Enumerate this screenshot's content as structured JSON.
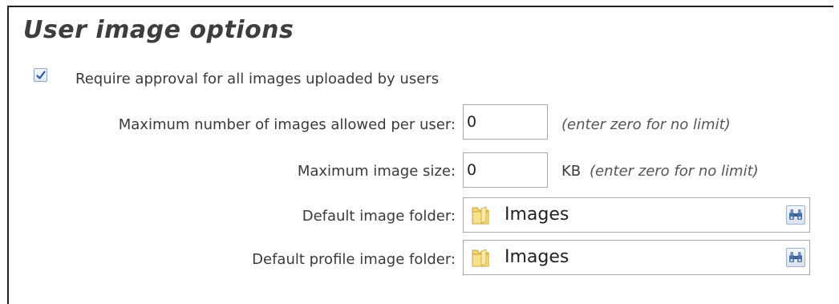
{
  "section": {
    "title": "User image options"
  },
  "approval": {
    "checked": true,
    "label": "Require approval for all images uploaded by users"
  },
  "max_images": {
    "label": "Maximum number of images allowed per user:",
    "value": "0",
    "hint": "(enter zero for no limit)"
  },
  "max_size": {
    "label": "Maximum image size:",
    "value": "0",
    "unit": "KB",
    "hint": "(enter zero for no limit)"
  },
  "default_folder": {
    "label": "Default image folder:",
    "value": "Images",
    "icon": "folder-icon",
    "button_icon": "binoculars-icon"
  },
  "profile_folder": {
    "label": "Default profile image folder:",
    "value": "Images",
    "icon": "folder-icon",
    "button_icon": "binoculars-icon"
  },
  "colors": {
    "accent": "#4a6fa5",
    "folder": "#f2c94c"
  }
}
